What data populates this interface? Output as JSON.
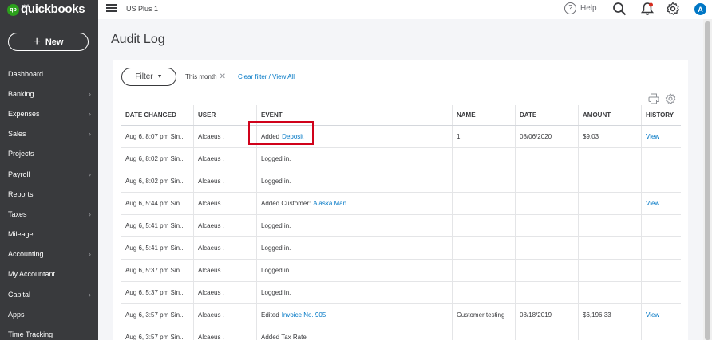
{
  "brand": {
    "intuit": "intuit",
    "name": "quickbooks",
    "badge": "qb"
  },
  "sidebar": {
    "new_label": "New",
    "items": [
      {
        "label": "Dashboard",
        "chevron": false
      },
      {
        "label": "Banking",
        "chevron": true
      },
      {
        "label": "Expenses",
        "chevron": true
      },
      {
        "label": "Sales",
        "chevron": true
      },
      {
        "label": "Projects",
        "chevron": false
      },
      {
        "label": "Payroll",
        "chevron": true
      },
      {
        "label": "Reports",
        "chevron": false
      },
      {
        "label": "Taxes",
        "chevron": true
      },
      {
        "label": "Mileage",
        "chevron": false
      },
      {
        "label": "Accounting",
        "chevron": true
      },
      {
        "label": "My Accountant",
        "chevron": false
      },
      {
        "label": "Capital",
        "chevron": true
      },
      {
        "label": "Apps",
        "chevron": false
      },
      {
        "label": "Time Tracking",
        "chevron": false
      }
    ]
  },
  "topbar": {
    "company": "US Plus 1",
    "help_label": "Help",
    "help_glyph": "?",
    "avatar_initial": "A"
  },
  "page": {
    "title": "Audit Log",
    "filter_label": "Filter",
    "filter_chip": "This month",
    "clear_link": "Clear filter / View All"
  },
  "table": {
    "headers": [
      "DATE CHANGED",
      "USER",
      "EVENT",
      "NAME",
      "DATE",
      "AMOUNT",
      "HISTORY"
    ],
    "rows": [
      {
        "date_changed": "Aug 6, 8:07 pm Sin...",
        "user": "Alcaeus .",
        "event_text": "Added",
        "event_link": "Deposit",
        "name": "1",
        "date": "08/06/2020",
        "amount": "$9.03",
        "history": "View"
      },
      {
        "date_changed": "Aug 6, 8:02 pm Sin...",
        "user": "Alcaeus .",
        "event_text": "Logged in.",
        "event_link": "",
        "name": "",
        "date": "",
        "amount": "",
        "history": ""
      },
      {
        "date_changed": "Aug 6, 8:02 pm Sin...",
        "user": "Alcaeus .",
        "event_text": "Logged in.",
        "event_link": "",
        "name": "",
        "date": "",
        "amount": "",
        "history": ""
      },
      {
        "date_changed": "Aug 6, 5:44 pm Sin...",
        "user": "Alcaeus .",
        "event_text": "Added Customer:",
        "event_link": "Alaska Man",
        "name": "",
        "date": "",
        "amount": "",
        "history": "View"
      },
      {
        "date_changed": "Aug 6, 5:41 pm Sin...",
        "user": "Alcaeus .",
        "event_text": "Logged in.",
        "event_link": "",
        "name": "",
        "date": "",
        "amount": "",
        "history": ""
      },
      {
        "date_changed": "Aug 6, 5:41 pm Sin...",
        "user": "Alcaeus .",
        "event_text": "Logged in.",
        "event_link": "",
        "name": "",
        "date": "",
        "amount": "",
        "history": ""
      },
      {
        "date_changed": "Aug 6, 5:37 pm Sin...",
        "user": "Alcaeus .",
        "event_text": "Logged in.",
        "event_link": "",
        "name": "",
        "date": "",
        "amount": "",
        "history": ""
      },
      {
        "date_changed": "Aug 6, 5:37 pm Sin...",
        "user": "Alcaeus .",
        "event_text": "Logged in.",
        "event_link": "",
        "name": "",
        "date": "",
        "amount": "",
        "history": ""
      },
      {
        "date_changed": "Aug 6, 3:57 pm Sin...",
        "user": "Alcaeus .",
        "event_text": "Edited",
        "event_link": "Invoice No. 905",
        "name": "Customer testing",
        "date": "08/18/2019",
        "amount": "$6,196.33",
        "history": "View"
      },
      {
        "date_changed": "Aug 6, 3:57 pm Sin...",
        "user": "Alcaeus .",
        "event_text": "Added Tax Rate",
        "event_link": "",
        "name": "",
        "date": "",
        "amount": "",
        "history": ""
      }
    ]
  },
  "colors": {
    "sidebar_bg": "#393a3d",
    "brand_green": "#2ca01c",
    "link_blue": "#0077c5",
    "highlight_red": "#d0021b",
    "page_bg": "#f4f5f8"
  },
  "icons": [
    "menu-icon",
    "help-icon",
    "search-icon",
    "bell-icon",
    "gear-icon",
    "print-icon",
    "settings-icon",
    "close-icon",
    "chevron-right-icon",
    "caret-down-icon",
    "plus-icon"
  ]
}
